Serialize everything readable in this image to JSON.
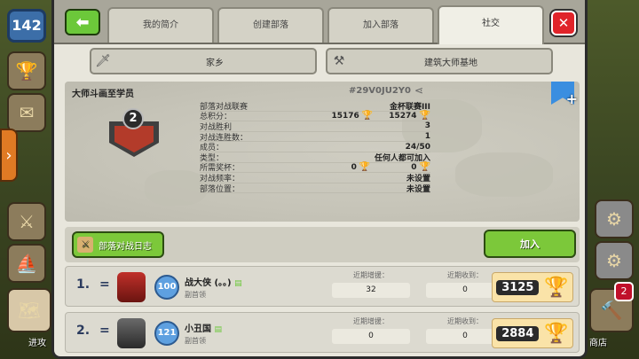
{
  "hud": {
    "xp_level": "142",
    "attack_label": "进攻",
    "shop_label": "商店",
    "notification_count": "2"
  },
  "tabs": [
    {
      "label": "我的简介"
    },
    {
      "label": "创建部落"
    },
    {
      "label": "加入部落"
    },
    {
      "label": "社交"
    }
  ],
  "subtabs": {
    "home": "家乡",
    "builder_base": "建筑大师基地"
  },
  "clan": {
    "name": "大师斗画至学员",
    "tag": "#29V0JU2Y0",
    "level": "2",
    "stats": [
      {
        "label": "部落对战联赛",
        "value": "金杯联赛III"
      },
      {
        "label": "总积分：",
        "value": "15176",
        "value2": "15274"
      },
      {
        "label": "对战胜利",
        "value": "3"
      },
      {
        "label": "对战连胜数：",
        "value": "1"
      },
      {
        "label": "成员：",
        "value": "24/50"
      },
      {
        "label": "类型：",
        "value": "任何人都可加入"
      },
      {
        "label": "所需奖杯：",
        "value": "0",
        "value2": "0"
      },
      {
        "label": "对战频率：",
        "value": "未设置"
      },
      {
        "label": "部落位置：",
        "value": "未设置"
      }
    ]
  },
  "actions": {
    "war_log": "部落对战日志",
    "join": "加入"
  },
  "members": [
    {
      "rank": "1.",
      "change": "=",
      "exp_level": "100",
      "name": "战大侠 (。。)",
      "role": "副首领",
      "donated_label": "近期增援：",
      "donated": "32",
      "received_label": "近期收到：",
      "received": "0",
      "trophies": "3125"
    },
    {
      "rank": "2.",
      "change": "=",
      "exp_level": "121",
      "name": "小丑国",
      "role": "副首领",
      "donated_label": "近期增援：",
      "donated": "0",
      "received_label": "近期收到：",
      "received": "0",
      "trophies": "2884"
    }
  ],
  "colors": {
    "accent_green": "#7cc83a",
    "close_red": "#e0242a",
    "trophy_gold": "#e8b020"
  }
}
